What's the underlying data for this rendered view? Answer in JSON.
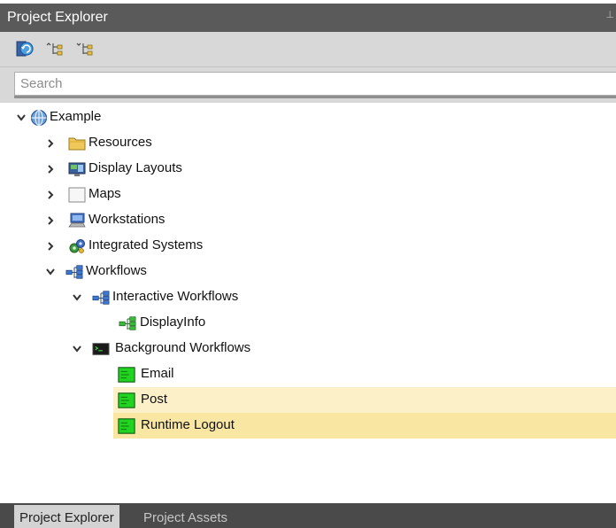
{
  "panel": {
    "title": "Project Explorer",
    "pin_icon": "pin-icon"
  },
  "toolbar": {
    "icons": [
      "refresh-icon",
      "expand-all-icon",
      "collapse-all-icon"
    ]
  },
  "search": {
    "placeholder": "Search",
    "value": ""
  },
  "tree": [
    {
      "label": "Example",
      "icon": "globe-icon",
      "expanded": true,
      "highlight": null
    },
    {
      "label": "Resources",
      "icon": "folder-icon",
      "expanded": false,
      "highlight": null
    },
    {
      "label": "Display Layouts",
      "icon": "display-layout-icon",
      "expanded": false,
      "highlight": null
    },
    {
      "label": "Maps",
      "icon": "map-icon",
      "expanded": false,
      "highlight": null
    },
    {
      "label": "Workstations",
      "icon": "workstation-icon",
      "expanded": false,
      "highlight": null
    },
    {
      "label": "Integrated Systems",
      "icon": "integrated-systems-icon",
      "expanded": false,
      "highlight": null
    },
    {
      "label": "Workflows",
      "icon": "workflow-icon",
      "expanded": true,
      "highlight": null
    },
    {
      "label": "Interactive Workflows",
      "icon": "workflow-icon",
      "expanded": true,
      "highlight": null
    },
    {
      "label": "DisplayInfo",
      "icon": "interactive-workflow-item-icon",
      "expanded": null,
      "highlight": null
    },
    {
      "label": "Background Workflows",
      "icon": "console-icon",
      "expanded": true,
      "highlight": null
    },
    {
      "label": "Email",
      "icon": "background-workflow-item-icon",
      "expanded": null,
      "highlight": null
    },
    {
      "label": "Post",
      "icon": "background-workflow-item-icon",
      "expanded": null,
      "highlight": "hover"
    },
    {
      "label": "Runtime Logout",
      "icon": "background-workflow-item-icon",
      "expanded": null,
      "highlight": "selected"
    }
  ],
  "tabs": [
    {
      "label": "Project Explorer",
      "active": true
    },
    {
      "label": "Project Assets",
      "active": false
    }
  ],
  "colors": {
    "hover": "#fbf0c8",
    "selected": "#f9e6a3",
    "titlebar": "#5a5a5a",
    "toolbar": "#d8d8d8",
    "tabbar": "#4a4a4a"
  }
}
